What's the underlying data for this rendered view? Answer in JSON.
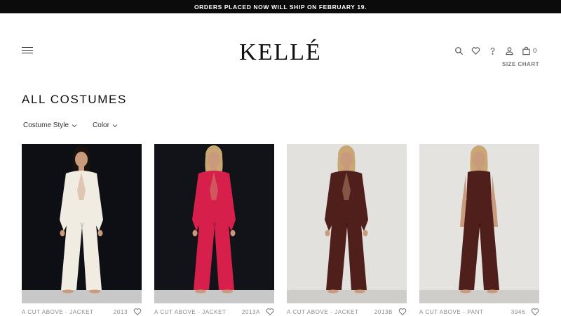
{
  "announcement": "ORDERS PLACED NOW WILL SHIP ON FEBRUARY 19.",
  "header": {
    "logo": "KELLÉ",
    "bag_count": "0",
    "size_chart": "SIZE CHART"
  },
  "page": {
    "title": "ALL COSTUMES"
  },
  "filters": [
    {
      "label": "Costume Style"
    },
    {
      "label": "Color"
    }
  ],
  "products": [
    {
      "name": "A CUT ABOVE - JACKET",
      "sku": "2013",
      "color": "#f1ece1",
      "bg": "#0e0f14"
    },
    {
      "name": "A CUT ABOVE - JACKET",
      "sku": "2013A",
      "color": "#d61f4a",
      "bg": "#121318"
    },
    {
      "name": "A CUT ABOVE - JACKET",
      "sku": "2013B",
      "color": "#4e1f1b",
      "bg": "#e3e1dd"
    },
    {
      "name": "A CUT ABOVE - PANT",
      "sku": "3946",
      "color": "#4e1f1b",
      "bg": "#e5e3df"
    }
  ],
  "icons": [
    "menu-icon",
    "search-icon",
    "heart-icon",
    "help-icon",
    "account-icon",
    "bag-icon",
    "chevron-down-icon"
  ]
}
